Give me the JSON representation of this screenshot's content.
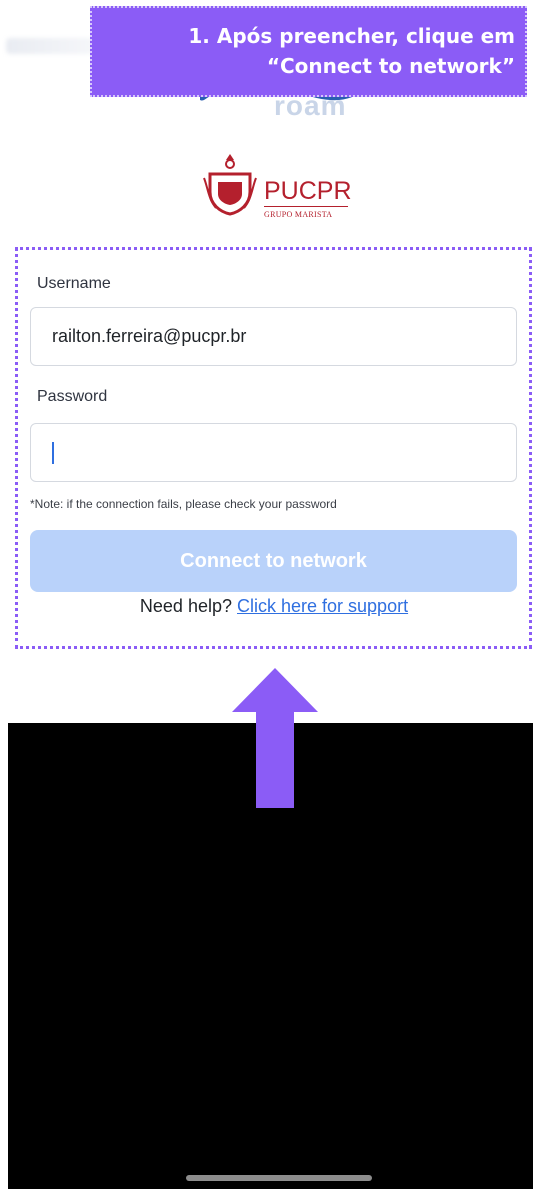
{
  "callout": {
    "line1": "1. Após preencher, clique em",
    "line2": "“Connect to network”"
  },
  "logos": {
    "eduroam_text": "roam",
    "pucpr_name": "PUCPR",
    "pucpr_subtitle": "GRUPO MARISTA"
  },
  "form": {
    "username_label": "Username",
    "username_value": "railton.ferreira@pucpr.br",
    "password_label": "Password",
    "password_value": "",
    "note": "*Note: if the connection fails, please check your password",
    "connect_label": "Connect to network",
    "help_prefix": "Need help?",
    "help_link": "Click here for support"
  },
  "colors": {
    "accent_purple": "#8b5cf6",
    "button_disabled": "#b9d2fa",
    "link_blue": "#2f6fe0",
    "pucpr_red": "#b4202d"
  },
  "icons": [
    "up-arrow-icon",
    "pucpr-crest-icon",
    "eduroam-swoosh-icon"
  ]
}
